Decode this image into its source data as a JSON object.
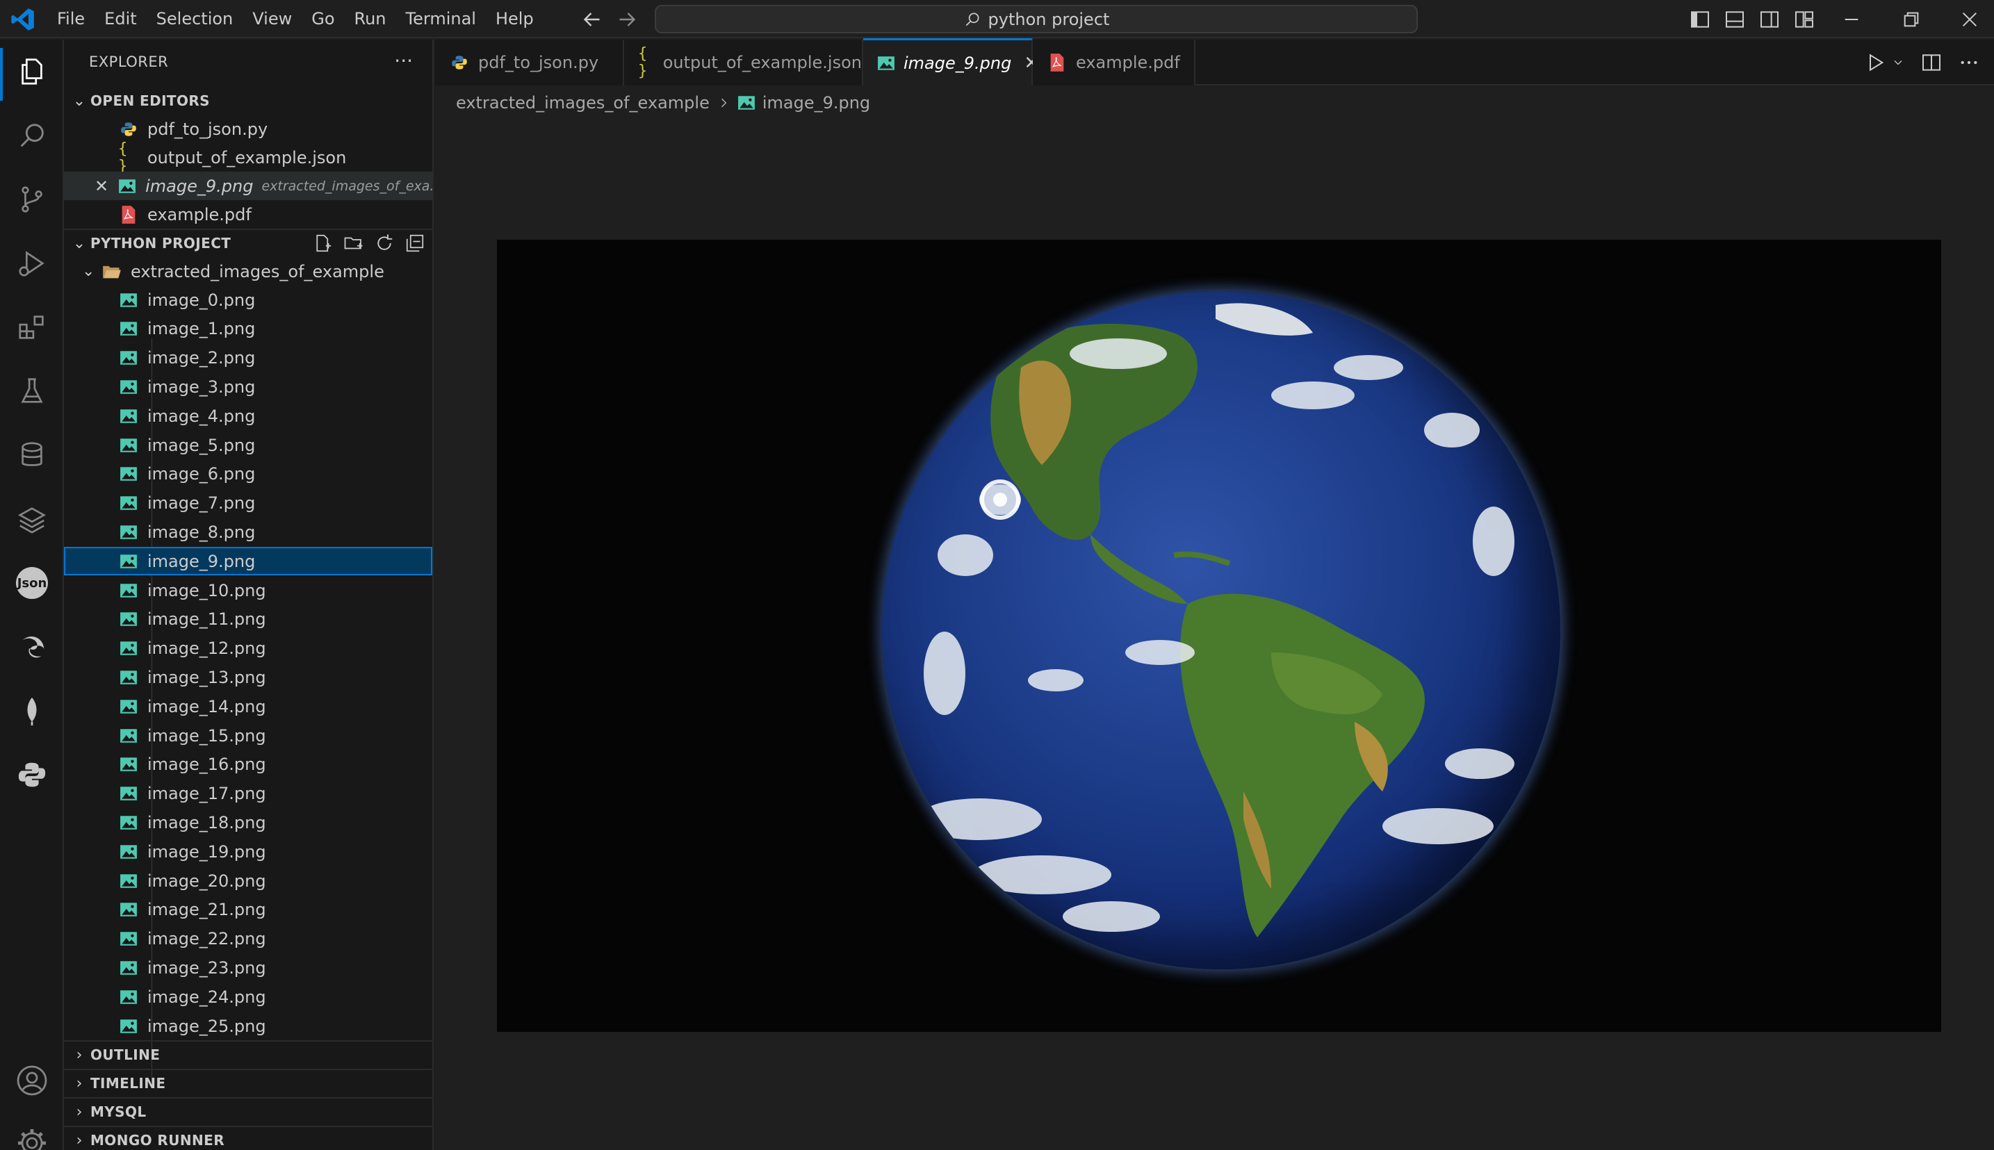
{
  "menu": [
    "File",
    "Edit",
    "Selection",
    "View",
    "Go",
    "Run",
    "Terminal",
    "Help"
  ],
  "command_center": {
    "text": "python project",
    "icon": "search-icon"
  },
  "explorer": {
    "title": "EXPLORER",
    "open_editors": {
      "label": "OPEN EDITORS",
      "items": [
        {
          "name": "pdf_to_json.py",
          "icon": "python-icon"
        },
        {
          "name": "output_of_example.json",
          "icon": "json-icon"
        },
        {
          "name": "image_9.png",
          "description": "extracted_images_of_exa...",
          "icon": "image-icon",
          "active": true
        },
        {
          "name": "example.pdf",
          "icon": "pdf-icon"
        }
      ]
    },
    "project": {
      "label": "PYTHON PROJECT",
      "folder": "extracted_images_of_example",
      "files": [
        "image_0.png",
        "image_1.png",
        "image_2.png",
        "image_3.png",
        "image_4.png",
        "image_5.png",
        "image_6.png",
        "image_7.png",
        "image_8.png",
        "image_9.png",
        "image_10.png",
        "image_11.png",
        "image_12.png",
        "image_13.png",
        "image_14.png",
        "image_15.png",
        "image_16.png",
        "image_17.png",
        "image_18.png",
        "image_19.png",
        "image_20.png",
        "image_21.png",
        "image_22.png",
        "image_23.png",
        "image_24.png",
        "image_25.png"
      ],
      "selected": "image_9.png"
    },
    "collapsed_sections": [
      "OUTLINE",
      "TIMELINE",
      "MYSQL",
      "MONGO RUNNER"
    ]
  },
  "tabs": [
    {
      "label": "pdf_to_json.py",
      "icon": "python-icon"
    },
    {
      "label": "output_of_example.json",
      "icon": "json-icon"
    },
    {
      "label": "image_9.png",
      "icon": "image-icon",
      "active": true
    },
    {
      "label": "example.pdf",
      "icon": "pdf-icon"
    }
  ],
  "breadcrumb": {
    "folder": "extracted_images_of_example",
    "file": "image_9.png"
  },
  "colors": {
    "accent": "#0078d4",
    "selection": "#04395e",
    "image_icon": "#4ec9b0",
    "pdf_icon": "#e05252",
    "python_blue": "#3b77a8",
    "python_yellow": "#f5d04c"
  }
}
